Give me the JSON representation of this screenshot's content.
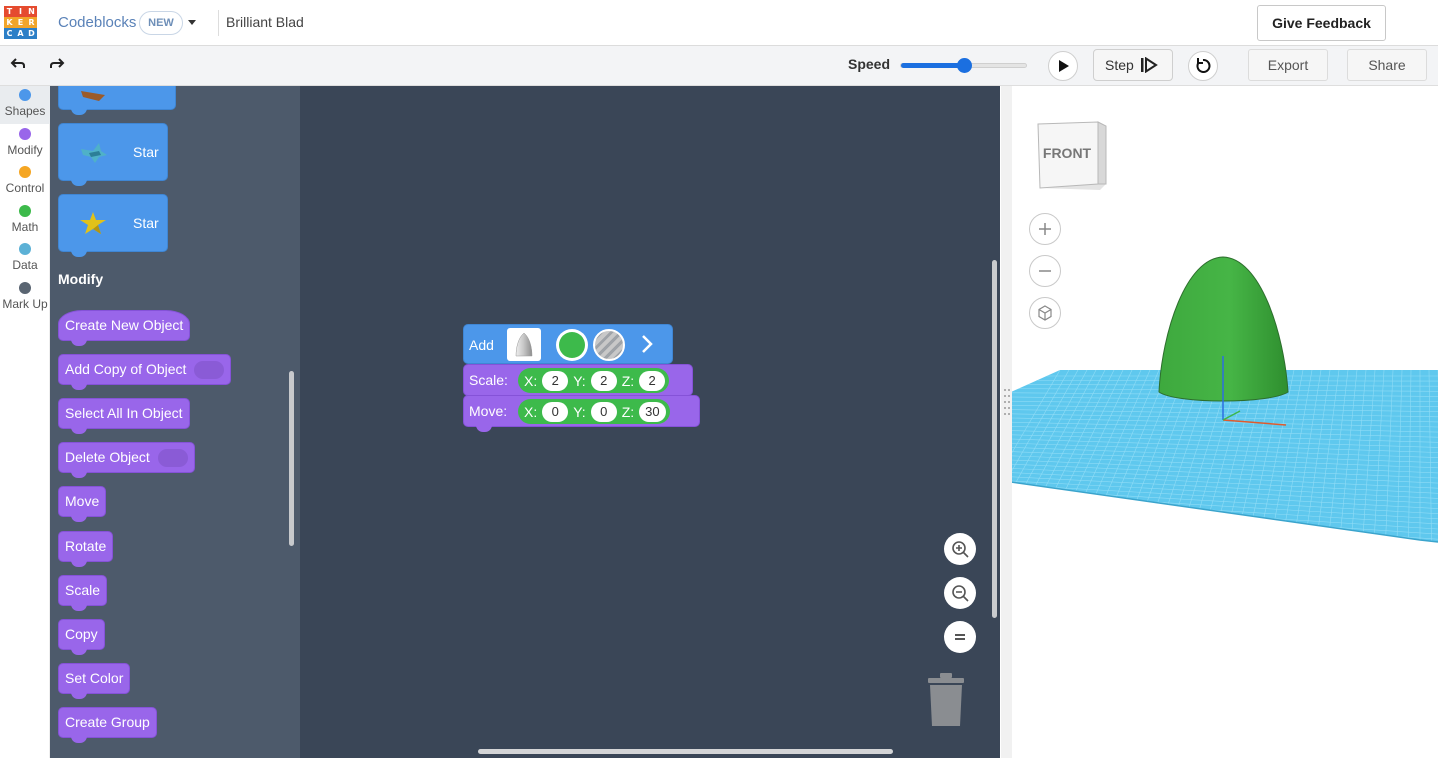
{
  "header": {
    "logo_letters": [
      "T",
      "I",
      "N",
      "K",
      "E",
      "R",
      "C",
      "A",
      "D"
    ],
    "logo_colors": [
      "#e54b2f",
      "#e54b2f",
      "#e54b2f",
      "#f1a52a",
      "#f1a52a",
      "#f1a52a",
      "#2c7fc7",
      "#2c7fc7",
      "#2c7fc7"
    ],
    "app_name": "Codeblocks",
    "badge": "NEW",
    "project_title": "Brilliant Blad",
    "feedback_label": "Give Feedback"
  },
  "toolbar": {
    "undo_icon": "undo-arrow-icon",
    "redo_icon": "redo-arrow-icon",
    "speed_label": "Speed",
    "speed_value": 0.5,
    "step_label": "Step",
    "export_label": "Export",
    "share_label": "Share"
  },
  "categories": [
    {
      "label": "Shapes",
      "color": "#4c97ea",
      "active": true
    },
    {
      "label": "Modify",
      "color": "#9966ea"
    },
    {
      "label": "Control",
      "color": "#f5a623"
    },
    {
      "label": "Math",
      "color": "#3dba4b"
    },
    {
      "label": "Data",
      "color": "#5cb1d6"
    },
    {
      "label": "Mark Up",
      "color": "#5a6572"
    }
  ],
  "flyout": {
    "shape_blocks": [
      "Star",
      "Star"
    ],
    "section_title": "Modify",
    "modify_blocks": [
      "Create New Object",
      "Add Copy of Object",
      "Select All In Object",
      "Delete Object",
      "Move",
      "Rotate",
      "Scale",
      "Copy",
      "Set Color",
      "Create Group"
    ]
  },
  "workspace": {
    "add_label": "Add",
    "shape_color": "#3dba4b",
    "scale": {
      "label": "Scale:",
      "x": "2",
      "y": "2",
      "z": "2"
    },
    "move": {
      "label": "Move:",
      "x": "0",
      "y": "0",
      "z": "30"
    },
    "axis_labels": {
      "x": "X:",
      "y": "Y:",
      "z": "Z:"
    }
  },
  "viewport": {
    "cube_label": "FRONT",
    "grid_color": "#5fc8ee",
    "object_color": "#3c9f3c"
  }
}
